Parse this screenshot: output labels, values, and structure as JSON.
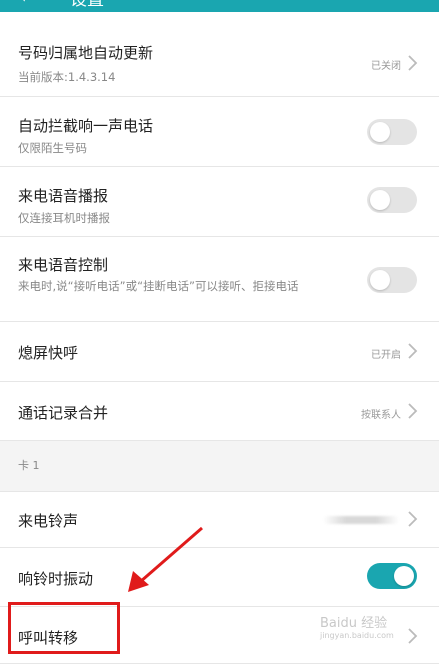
{
  "header": {
    "back_icon": "back-arrow-icon",
    "title": "设置"
  },
  "settings": {
    "number_update": {
      "title": "号码归属地自动更新",
      "subtitle": "当前版本:1.4.3.14",
      "value": "已关闭"
    },
    "block_one_ring": {
      "title": "自动拦截响一声电话",
      "subtitle": "仅限陌生号码",
      "toggle": false
    },
    "voice_announce": {
      "title": "来电语音播报",
      "subtitle": "仅连接耳机时播报",
      "toggle": false
    },
    "voice_control": {
      "title": "来电语音控制",
      "subtitle": "来电时,说“接听电话”或“挂断电话”可以接听、拒接电话",
      "toggle": false
    },
    "screen_off_call": {
      "title": "熄屏快呼",
      "value": "已开启"
    },
    "merge_call_log": {
      "title": "通话记录合并",
      "value": "按联系人"
    }
  },
  "card_section": {
    "label": "卡 1"
  },
  "card_settings": {
    "ringtone": {
      "title": "来电铃声"
    },
    "vibrate": {
      "title": "响铃时振动",
      "toggle": true
    },
    "call_forward": {
      "title": "呼叫转移"
    }
  },
  "watermark": {
    "line1": "Baidu 经验",
    "line2": "jingyan.baidu.com"
  },
  "colors": {
    "accent": "#1aa6b0",
    "highlight": "#e01b1b"
  }
}
